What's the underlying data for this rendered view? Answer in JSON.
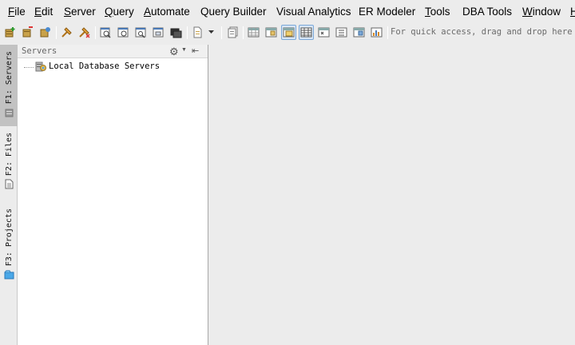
{
  "menu": {
    "items": [
      {
        "mnemonic": "F",
        "rest": "ile"
      },
      {
        "mnemonic": "E",
        "rest": "dit"
      },
      {
        "mnemonic": "S",
        "rest": "erver"
      },
      {
        "mnemonic": "Q",
        "rest": "uery"
      },
      {
        "mnemonic": "A",
        "rest": "utomate"
      },
      {
        "mnemonic": "",
        "rest": "Query Builder"
      },
      {
        "mnemonic": "",
        "rest": "Visual Analytics"
      },
      {
        "mnemonic": "",
        "rest": "ER Modeler"
      },
      {
        "mnemonic": "T",
        "rest": "ools"
      },
      {
        "mnemonic": "",
        "rest": "DBA Tools"
      },
      {
        "mnemonic": "W",
        "rest": "indow"
      },
      {
        "mnemonic": "H",
        "rest": ""
      }
    ]
  },
  "toolbar": {
    "hint": "For quick access, drag and drop here to"
  },
  "sidebar": {
    "tabs": [
      {
        "label": "F1: Servers",
        "selected": true
      },
      {
        "label": "F2: Files",
        "selected": false
      },
      {
        "label": "F3: Projects",
        "selected": false
      }
    ]
  },
  "panel": {
    "title": "Servers",
    "tree": [
      {
        "label": "Local Database Servers"
      }
    ]
  },
  "colors": {
    "accent": "#7aa7d8",
    "selected_tab": "#c2c2c2"
  }
}
